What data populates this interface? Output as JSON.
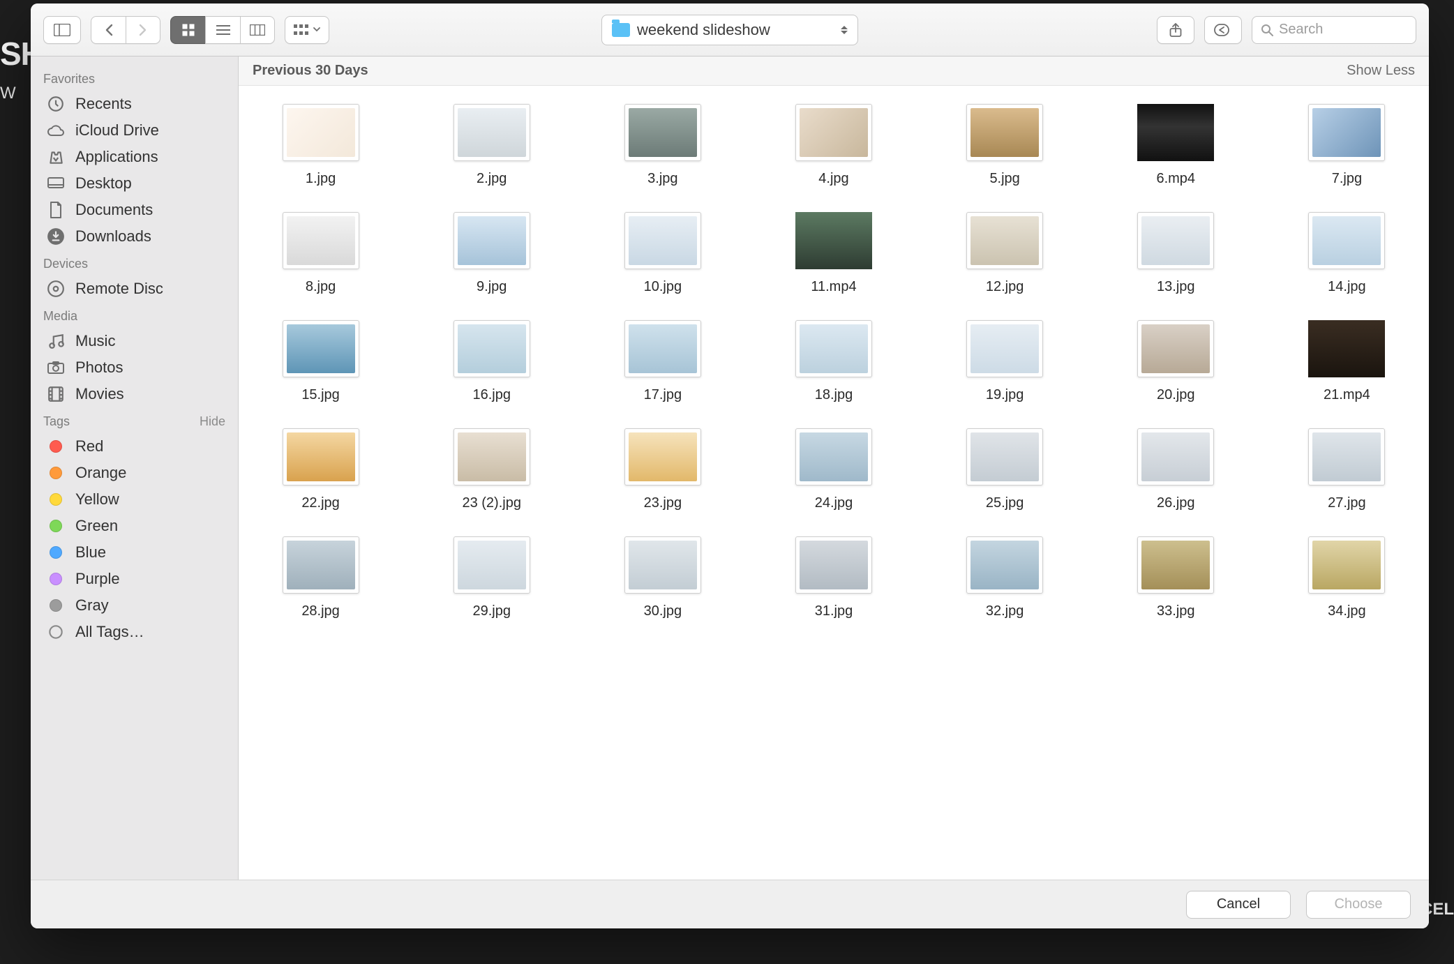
{
  "backdrop": {
    "leftBrand": "SH",
    "leftSub": "W",
    "rightCancel": "CEL"
  },
  "toolbar": {
    "path_label": "weekend slideshow",
    "search_placeholder": "Search"
  },
  "sidebar": {
    "favorites": {
      "header": "Favorites",
      "items": [
        {
          "id": "recents",
          "label": "Recents"
        },
        {
          "id": "icloud",
          "label": "iCloud Drive"
        },
        {
          "id": "applications",
          "label": "Applications"
        },
        {
          "id": "desktop",
          "label": "Desktop"
        },
        {
          "id": "documents",
          "label": "Documents"
        },
        {
          "id": "downloads",
          "label": "Downloads"
        }
      ]
    },
    "devices": {
      "header": "Devices",
      "items": [
        {
          "id": "remote-disc",
          "label": "Remote Disc"
        }
      ]
    },
    "media": {
      "header": "Media",
      "items": [
        {
          "id": "music",
          "label": "Music"
        },
        {
          "id": "photos",
          "label": "Photos"
        },
        {
          "id": "movies",
          "label": "Movies"
        }
      ]
    },
    "tags": {
      "header": "Tags",
      "hide_label": "Hide",
      "items": [
        {
          "id": "red",
          "label": "Red",
          "color": "#ff5b4f"
        },
        {
          "id": "orange",
          "label": "Orange",
          "color": "#ff9a3b"
        },
        {
          "id": "yellow",
          "label": "Yellow",
          "color": "#ffd93b"
        },
        {
          "id": "green",
          "label": "Green",
          "color": "#7ed858"
        },
        {
          "id": "blue",
          "label": "Blue",
          "color": "#4fa9ff"
        },
        {
          "id": "purple",
          "label": "Purple",
          "color": "#c98fff"
        },
        {
          "id": "gray",
          "label": "Gray",
          "color": "#9c9c9c"
        },
        {
          "id": "all",
          "label": "All Tags…",
          "color": null
        }
      ]
    }
  },
  "files": {
    "section_header": "Previous 30 Days",
    "show_less": "Show Less",
    "items": [
      {
        "name": "1.jpg",
        "type": "image",
        "g": "g1"
      },
      {
        "name": "2.jpg",
        "type": "image",
        "g": "g2"
      },
      {
        "name": "3.jpg",
        "type": "image",
        "g": "g3"
      },
      {
        "name": "4.jpg",
        "type": "image",
        "g": "g4"
      },
      {
        "name": "5.jpg",
        "type": "image",
        "g": "g5"
      },
      {
        "name": "6.mp4",
        "type": "video",
        "g": "g6"
      },
      {
        "name": "7.jpg",
        "type": "image",
        "g": "g7"
      },
      {
        "name": "8.jpg",
        "type": "image",
        "g": "g8"
      },
      {
        "name": "9.jpg",
        "type": "image",
        "g": "g9"
      },
      {
        "name": "10.jpg",
        "type": "image",
        "g": "g10"
      },
      {
        "name": "11.mp4",
        "type": "video",
        "g": "g11"
      },
      {
        "name": "12.jpg",
        "type": "image",
        "g": "g12"
      },
      {
        "name": "13.jpg",
        "type": "image",
        "g": "g13"
      },
      {
        "name": "14.jpg",
        "type": "image",
        "g": "g14"
      },
      {
        "name": "15.jpg",
        "type": "image",
        "g": "g15"
      },
      {
        "name": "16.jpg",
        "type": "image",
        "g": "g16"
      },
      {
        "name": "17.jpg",
        "type": "image",
        "g": "g17"
      },
      {
        "name": "18.jpg",
        "type": "image",
        "g": "g18"
      },
      {
        "name": "19.jpg",
        "type": "image",
        "g": "g19"
      },
      {
        "name": "20.jpg",
        "type": "image",
        "g": "g20"
      },
      {
        "name": "21.mp4",
        "type": "video",
        "g": "g21"
      },
      {
        "name": "22.jpg",
        "type": "image",
        "g": "g22"
      },
      {
        "name": "23 (2).jpg",
        "type": "image",
        "g": "g23"
      },
      {
        "name": "23.jpg",
        "type": "image",
        "g": "g24"
      },
      {
        "name": "24.jpg",
        "type": "image",
        "g": "g25"
      },
      {
        "name": "25.jpg",
        "type": "image",
        "g": "g26"
      },
      {
        "name": "26.jpg",
        "type": "image",
        "g": "g27"
      },
      {
        "name": "27.jpg",
        "type": "image",
        "g": "g28"
      },
      {
        "name": "28.jpg",
        "type": "image",
        "g": "g29"
      },
      {
        "name": "29.jpg",
        "type": "image",
        "g": "g30"
      },
      {
        "name": "30.jpg",
        "type": "image",
        "g": "g31"
      },
      {
        "name": "31.jpg",
        "type": "image",
        "g": "g32"
      },
      {
        "name": "32.jpg",
        "type": "image",
        "g": "g33"
      },
      {
        "name": "33.jpg",
        "type": "image",
        "g": "g34"
      },
      {
        "name": "34.jpg",
        "type": "image",
        "g": "g35"
      }
    ]
  },
  "footer": {
    "cancel": "Cancel",
    "choose": "Choose"
  },
  "colors": {
    "accent": "#4fa9ff",
    "sidebar_bg": "#e9e8e9",
    "toolbar_bg": "#f3f3f3"
  }
}
